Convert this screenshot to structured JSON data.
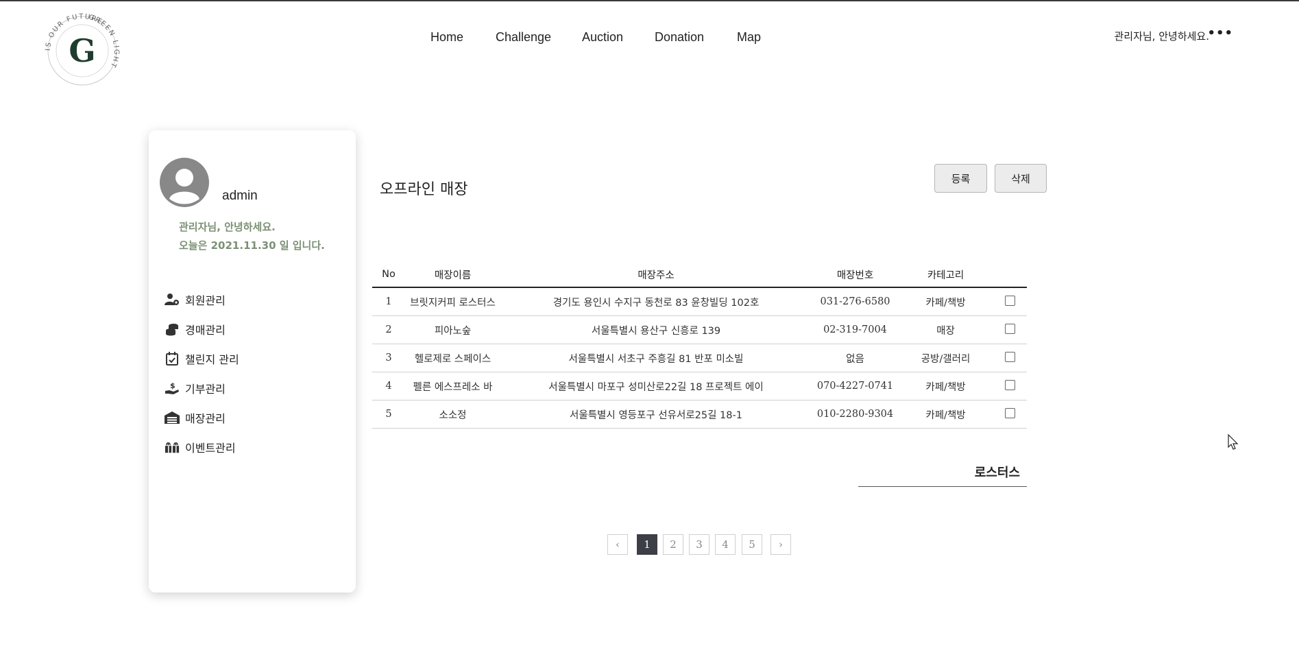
{
  "logo": {
    "ring_text_top": "GREEN LIGHT",
    "ring_text_bottom": "IS OUR FUTURE",
    "letter": "G"
  },
  "nav": {
    "items": [
      "Home",
      "Challenge",
      "Auction",
      "Donation",
      "Map"
    ]
  },
  "header": {
    "greeting": "관리자님, 안녕하세요.",
    "more": "•••"
  },
  "sidebar": {
    "username": "admin",
    "welcome_line1": "관리자님, 안녕하세요.",
    "welcome_line2": "오늘은 2021.11.30 일 입니다.",
    "menu": [
      {
        "label": "회원관리",
        "icon": "user-gear-icon"
      },
      {
        "label": "경매관리",
        "icon": "coins-icon"
      },
      {
        "label": "챌린지 관리",
        "icon": "calendar-check-icon"
      },
      {
        "label": "기부관리",
        "icon": "hand-dollar-icon"
      },
      {
        "label": "매장관리",
        "icon": "warehouse-icon"
      },
      {
        "label": "이벤트관리",
        "icon": "gift-icon"
      }
    ]
  },
  "main": {
    "title": "오프라인 매장",
    "register_label": "등록",
    "delete_label": "삭제",
    "columns": [
      "No",
      "매장이름",
      "매장주소",
      "매장번호",
      "카테고리"
    ],
    "rows": [
      {
        "no": "1",
        "name": "브릿지커피 로스터스",
        "address": "경기도 용인시 수지구 동천로 83 윤창빌딩 102호",
        "phone": "031-276-6580",
        "category": "카페/책방"
      },
      {
        "no": "2",
        "name": "피아노숲",
        "address": "서울특별시 용산구 신흥로 139",
        "phone": "02-319-7004",
        "category": "매장"
      },
      {
        "no": "3",
        "name": "헬로제로 스페이스",
        "address": "서울특별시 서초구 주흥길 81 반포 미소빌",
        "phone": "없음",
        "category": "공방/갤러리"
      },
      {
        "no": "4",
        "name": "펠른 에스프레소 바",
        "address": "서울특별시 마포구 성미산로22길 18 프로젝트 에이",
        "phone": "070-4227-0741",
        "category": "카페/책방"
      },
      {
        "no": "5",
        "name": "소소정",
        "address": "서울특별시 영등포구 선유서로25길 18-1",
        "phone": "010-2280-9304",
        "category": "카페/책방"
      }
    ],
    "search_value": "로스터스"
  },
  "pagination": {
    "prev": "‹",
    "next": "›",
    "pages": [
      "1",
      "2",
      "3",
      "4",
      "5"
    ],
    "current": "1"
  },
  "colors": {
    "accent_green": "#7b9074",
    "logo_green": "#1f3d2e",
    "active_page": "#3d3f47"
  }
}
